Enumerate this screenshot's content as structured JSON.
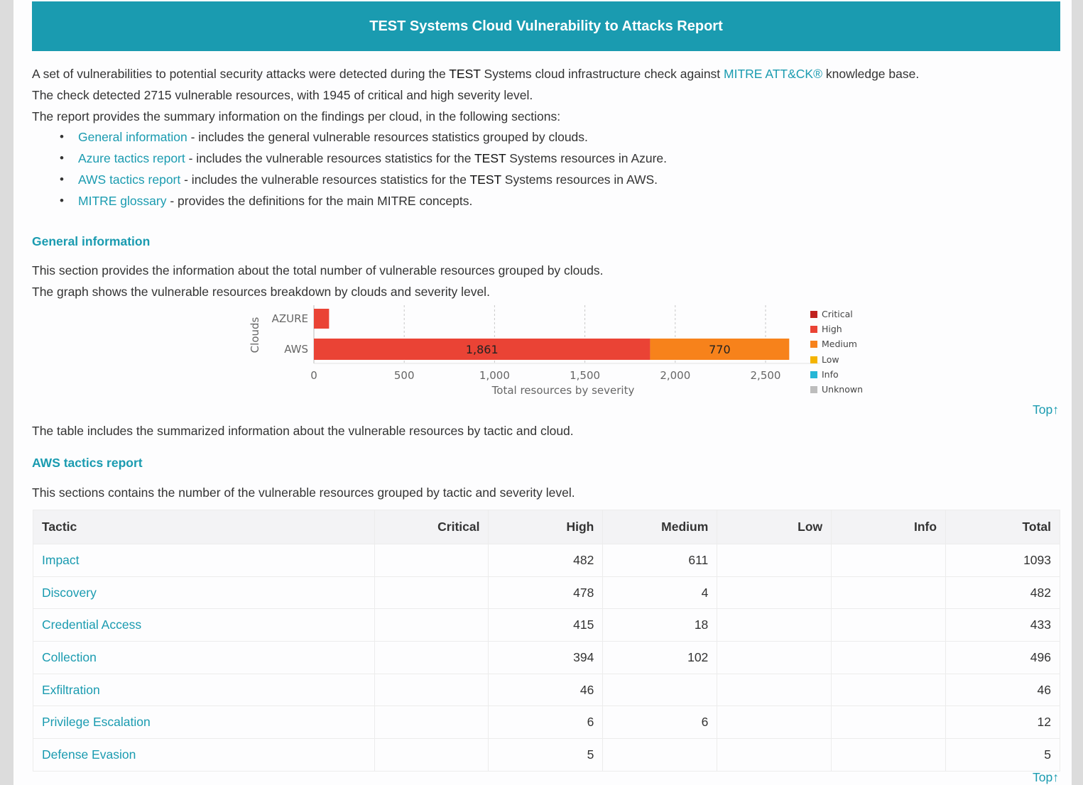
{
  "header": {
    "title": "TEST Systems Cloud Vulnerability to Attacks Report"
  },
  "intro": {
    "line1_a": "A set of vulnerabilities to potential security attacks were detected during the ",
    "line1_b": "TEST",
    "line1_c": " Systems cloud infrastructure check against ",
    "line1_link": "MITRE ATT&CK®",
    "line1_d": " knowledge base.",
    "line2": "The check detected 2715 vulnerable resources, with 1945 of critical and high severity level.",
    "line3": "The report provides the summary information on the findings per cloud, in the following sections:"
  },
  "toc": [
    {
      "link": "General information",
      "pre": "",
      "bold": "",
      "rest": " - includes the general vulnerable resources statistics grouped by clouds."
    },
    {
      "link": "Azure tactics report",
      "pre": " - includes the vulnerable resources statistics for the ",
      "bold": "TEST",
      "rest": " Systems resources in Azure."
    },
    {
      "link": "AWS tactics report",
      "pre": " - includes the vulnerable resources statistics for the ",
      "bold": "TEST",
      "rest": " Systems resources in AWS."
    },
    {
      "link": "MITRE glossary",
      "pre": "",
      "bold": "",
      "rest": " - provides the definitions for the main MITRE concepts."
    }
  ],
  "bullet": "•",
  "general": {
    "title": "General information",
    "line1": "This section provides the information about the total number of vulnerable resources grouped by clouds.",
    "line2": "The graph shows the vulnerable resources breakdown by clouds and severity level."
  },
  "top_link": "Top↑",
  "table_note": "The table includes the summarized information about the vulnerable resources by tactic and cloud.",
  "aws": {
    "title": "AWS tactics report",
    "description": "This sections contains the number of the vulnerable resources grouped by tactic and severity level."
  },
  "chart_data": {
    "type": "bar",
    "orientation": "horizontal",
    "stacked": true,
    "categories": [
      "AZURE",
      "AWS"
    ],
    "series": [
      {
        "name": "Critical",
        "color": "#c0221f",
        "values": [
          0,
          0
        ]
      },
      {
        "name": "High",
        "color": "#ea4335",
        "values": [
          84,
          1861
        ]
      },
      {
        "name": "Medium",
        "color": "#f7821b",
        "values": [
          0,
          770
        ]
      },
      {
        "name": "Low",
        "color": "#f4b400",
        "values": [
          0,
          0
        ]
      },
      {
        "name": "Info",
        "color": "#26b7d6",
        "values": [
          0,
          0
        ]
      },
      {
        "name": "Unknown",
        "color": "#bdbdbd",
        "values": [
          0,
          0
        ]
      }
    ],
    "data_labels": {
      "AWS": [
        "1,861",
        "770"
      ]
    },
    "xlabel": "Total resources by severity",
    "ylabel": "Clouds",
    "xlim": [
      0,
      2800
    ],
    "xticks": [
      "0",
      "500",
      "1,000",
      "1,500",
      "2,000",
      "2,500"
    ],
    "grid": true,
    "legend": "right"
  },
  "table": {
    "headers": [
      "Tactic",
      "Critical",
      "High",
      "Medium",
      "Low",
      "Info",
      "Total"
    ],
    "rows": [
      [
        "Impact",
        "",
        "482",
        "611",
        "",
        "",
        "1093"
      ],
      [
        "Discovery",
        "",
        "478",
        "4",
        "",
        "",
        "482"
      ],
      [
        "Credential Access",
        "",
        "415",
        "18",
        "",
        "",
        "433"
      ],
      [
        "Collection",
        "",
        "394",
        "102",
        "",
        "",
        "496"
      ],
      [
        "Exfiltration",
        "",
        "46",
        "",
        "",
        "",
        "46"
      ],
      [
        "Privilege Escalation",
        "",
        "6",
        "6",
        "",
        "",
        "12"
      ],
      [
        "Defense Evasion",
        "",
        "5",
        "",
        "",
        "",
        "5"
      ]
    ]
  }
}
